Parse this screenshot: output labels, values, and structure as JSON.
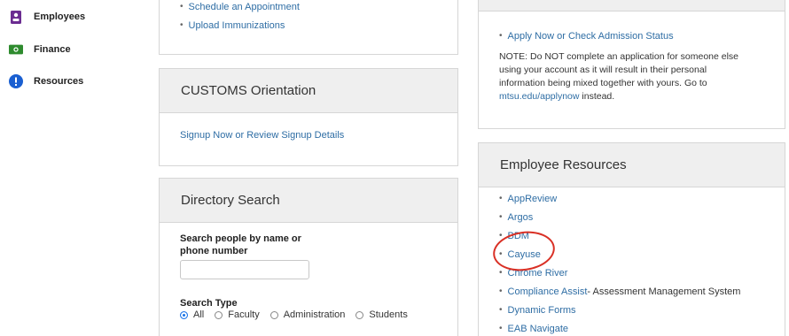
{
  "sidebar": {
    "items": [
      {
        "label": "Employees",
        "icon": "employee-badge-icon",
        "color": "#6b2c91"
      },
      {
        "label": "Finance",
        "icon": "money-icon",
        "color": "#2e8b2e"
      },
      {
        "label": "Resources",
        "icon": "info-icon",
        "color": "#1a5fd1"
      }
    ]
  },
  "appointments": {
    "links": [
      "Schedule an Appointment",
      "Upload Immunizations"
    ]
  },
  "customs": {
    "title": "CUSTOMS Orientation",
    "link": "Signup Now or Review Signup Details"
  },
  "directory": {
    "title": "Directory Search",
    "search_label_line1": "Search people by name or",
    "search_label_line2": "phone number",
    "search_placeholder": "",
    "type_label": "Search Type",
    "options": [
      "All",
      "Faculty",
      "Administration",
      "Students"
    ],
    "selected": "All"
  },
  "admissions": {
    "link": "Apply Now or Check Admission Status",
    "note_line1": "NOTE: Do NOT complete an application for someone else",
    "note_line2": "using your account as it will result in their personal",
    "note_line3": "information being mixed together with yours. Go to",
    "note_link": "mtsu.edu/applynow",
    "note_tail": " instead."
  },
  "employee_resources": {
    "title": "Employee Resources",
    "links": [
      {
        "label": "AppReview",
        "suffix": ""
      },
      {
        "label": "Argos",
        "suffix": ""
      },
      {
        "label": "BDM",
        "suffix": ""
      },
      {
        "label": "Cayuse",
        "suffix": ""
      },
      {
        "label": "Chrome River",
        "suffix": ""
      },
      {
        "label": "Compliance Assist",
        "suffix": " - Assessment Management System"
      },
      {
        "label": "Dynamic Forms",
        "suffix": ""
      },
      {
        "label": "EAB Navigate",
        "suffix": ""
      }
    ]
  },
  "annotation_color": "#d93025"
}
